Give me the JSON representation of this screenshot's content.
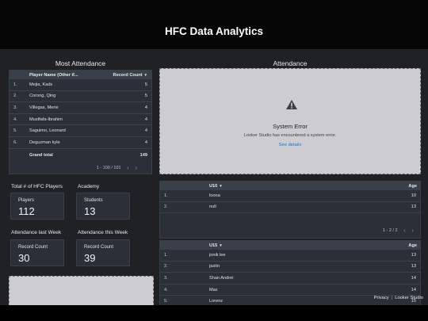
{
  "report": {
    "title": "HFC Data Analytics"
  },
  "most_attendance": {
    "title": "Most Attendance",
    "columns": {
      "name": "Player Name (Other if...",
      "count": "Record Count"
    },
    "rows": [
      {
        "idx": "1.",
        "name": "Mejia, Kads",
        "count": "5"
      },
      {
        "idx": "2.",
        "name": "Corong, Qing",
        "count": "5"
      },
      {
        "idx": "3.",
        "name": "Villegas, Merie",
        "count": "4"
      },
      {
        "idx": "4.",
        "name": "Mustfafa-Ibrahim",
        "count": "4"
      },
      {
        "idx": "5.",
        "name": "Saguimo, Leonard",
        "count": "4"
      },
      {
        "idx": "6.",
        "name": "Deguzman kyle",
        "count": "4"
      }
    ],
    "grand_total_label": "Grand total",
    "grand_total": "149",
    "pager": "1 - 100 / 101"
  },
  "attendance": {
    "title": "Attendance",
    "error_title": "System Error",
    "error_message": "Looker Studio has encountered a system error.",
    "details_link": "See details"
  },
  "scorecards": {
    "total_label": "Total # of HFC Players",
    "players_label": "Players",
    "players_value": "112",
    "academy_label": "Academy",
    "students_label": "Students",
    "students_value": "13",
    "last_week_label": "Attendance last Week",
    "last_week_sub": "Record Count",
    "last_week_value": "30",
    "this_week_label": "Attendance this Week",
    "this_week_sub": "Record Count",
    "this_week_value": "39"
  },
  "u10": {
    "header": "U10",
    "age_header": "Age",
    "rows": [
      {
        "idx": "1.",
        "name": "loona",
        "age": "10"
      },
      {
        "idx": "2.",
        "name": "null",
        "age": "13"
      }
    ],
    "pager": "1 - 2 / 2"
  },
  "u15": {
    "header": "U15",
    "age_header": "Age",
    "rows": [
      {
        "idx": "1.",
        "name": "jonik lee",
        "age": "13"
      },
      {
        "idx": "2.",
        "name": "jastin",
        "age": "13"
      },
      {
        "idx": "3.",
        "name": "Shan Andrei",
        "age": "14"
      },
      {
        "idx": "4.",
        "name": "Max",
        "age": "14"
      },
      {
        "idx": "5.",
        "name": "Lorenz",
        "age": "15"
      }
    ]
  },
  "footer": {
    "privacy": "Privacy",
    "brand": "Looker Studio"
  },
  "colors": {
    "background": "#202124",
    "panel": "#2b3038",
    "header_row": "#394049",
    "link": "#1a73e8"
  }
}
